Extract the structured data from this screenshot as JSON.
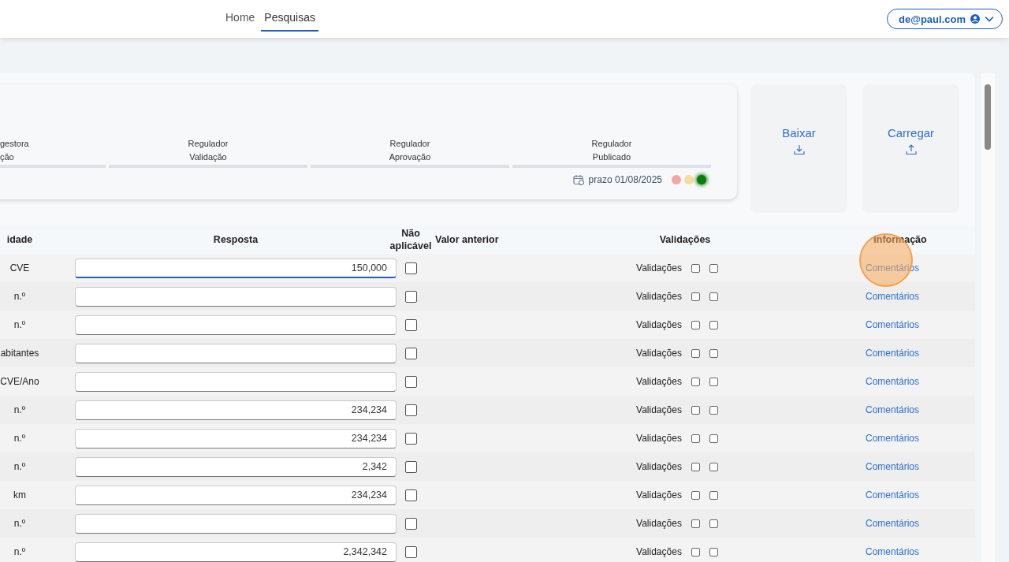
{
  "nav": {
    "links": [
      {
        "label": "Home",
        "selected": false
      },
      {
        "label": "Pesquisas",
        "selected": true
      }
    ],
    "user": "de@paul.com"
  },
  "workflow": {
    "steps": [
      {
        "lines": [
          "gestora",
          "ção"
        ],
        "done": false
      },
      {
        "lines": [
          "Regulador",
          "Validação"
        ],
        "done": false
      },
      {
        "lines": [
          "Regulador",
          "Aprovação"
        ],
        "done": false
      },
      {
        "lines": [
          "Regulador",
          "Publicado"
        ],
        "done": false
      }
    ],
    "deadline": "prazo 01/08/2025",
    "lights": [
      {
        "color": "#f4a6a6",
        "selected": false
      },
      {
        "color": "#f6dca0",
        "selected": false
      },
      {
        "color": "#0a7d0a",
        "selected": true
      }
    ]
  },
  "actions": [
    {
      "label": "Baixar",
      "kind": "download"
    },
    {
      "label": "Carregar",
      "kind": "upload"
    }
  ],
  "table": {
    "columns": [
      "idade",
      "Resposta",
      "Não aplicável",
      "Valor anterior",
      "Validações",
      "Informação"
    ],
    "rows": [
      {
        "unit": "CVE",
        "value": "150,000",
        "focused": true,
        "na": false,
        "validation_label": "Validações",
        "checks": [
          false,
          false
        ],
        "info": "Comentários"
      },
      {
        "unit": "n.º",
        "value": "",
        "focused": false,
        "na": false,
        "validation_label": "Validações",
        "checks": [
          false,
          false
        ],
        "info": "Comentários"
      },
      {
        "unit": "n.º",
        "value": "",
        "focused": false,
        "na": false,
        "validation_label": "Validações",
        "checks": [
          false,
          false
        ],
        "info": "Comentários"
      },
      {
        "unit": "abitantes",
        "value": "",
        "focused": false,
        "na": false,
        "validation_label": "Validações",
        "checks": [
          false,
          false
        ],
        "info": "Comentários"
      },
      {
        "unit": "CVE/Ano",
        "value": "",
        "focused": false,
        "na": false,
        "validation_label": "Validações",
        "checks": [
          false,
          false
        ],
        "info": "Comentários"
      },
      {
        "unit": "n.º",
        "value": "234,234",
        "focused": false,
        "na": false,
        "validation_label": "Validações",
        "checks": [
          false,
          false
        ],
        "info": "Comentários"
      },
      {
        "unit": "n.º",
        "value": "234,234",
        "focused": false,
        "na": false,
        "validation_label": "Validações",
        "checks": [
          false,
          false
        ],
        "info": "Comentários"
      },
      {
        "unit": "n.º",
        "value": "2,342",
        "focused": false,
        "na": false,
        "validation_label": "Validações",
        "checks": [
          false,
          false
        ],
        "info": "Comentários"
      },
      {
        "unit": "km",
        "value": "234,234",
        "focused": false,
        "na": false,
        "validation_label": "Validações",
        "checks": [
          false,
          false
        ],
        "info": "Comentários"
      },
      {
        "unit": "n.º",
        "value": "",
        "focused": false,
        "na": false,
        "validation_label": "Validações",
        "checks": [
          false,
          false
        ],
        "info": "Comentários"
      },
      {
        "unit": "n.º",
        "value": "2,342,342",
        "focused": false,
        "na": false,
        "validation_label": "Validações",
        "checks": [
          false,
          false
        ],
        "info": "Comentários"
      }
    ]
  }
}
